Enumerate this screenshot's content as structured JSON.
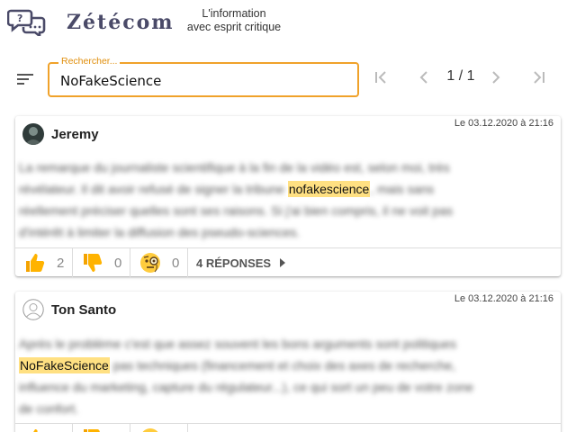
{
  "header": {
    "brand": "Zétécom",
    "tagline_line1": "L'information",
    "tagline_line2": "avec esprit critique"
  },
  "toolbar": {
    "search_label": "Rechercher...",
    "search_value": "NoFakeScience",
    "page_indicator": "1 / 1"
  },
  "colors": {
    "accent": "#f0a22a",
    "highlight": "#ffe082",
    "brand": "#4a4a68"
  },
  "comments": [
    {
      "author": "Jeremy",
      "date": "Le 03.12.2020 à 21:16",
      "text_1": "La remarque du journaliste scientifique à la fin de la vidéo est, selon moi, très",
      "text_2a": "révélateur. Il dit avoir refusé de signer la tribune",
      "highlight": "nofakescience",
      "text_2b": ", mais sans",
      "text_3": "réellement préciser quelles sont ses raisons. Si j'ai bien compris, il ne voit pas",
      "text_4": "d'intérêt à limiter la diffusion des pseudo-sciences.",
      "approve_count": "2",
      "refute_count": "0",
      "skeptic_count": "0",
      "replies_label": "4 RÉPONSES"
    },
    {
      "author": "Ton Santo",
      "date": "Le 03.12.2020 à 21:16",
      "text_1": "Après le problème c'est que assez souvent les bons arguments sont politiques",
      "highlight": "NoFakeScience",
      "text_2b": " pas techniques (financement et choix des axes de recherche,",
      "text_3": "influence du marketing, capture du régulateur...), ce qui sort un peu de votre zone",
      "text_4": "de confort."
    }
  ]
}
